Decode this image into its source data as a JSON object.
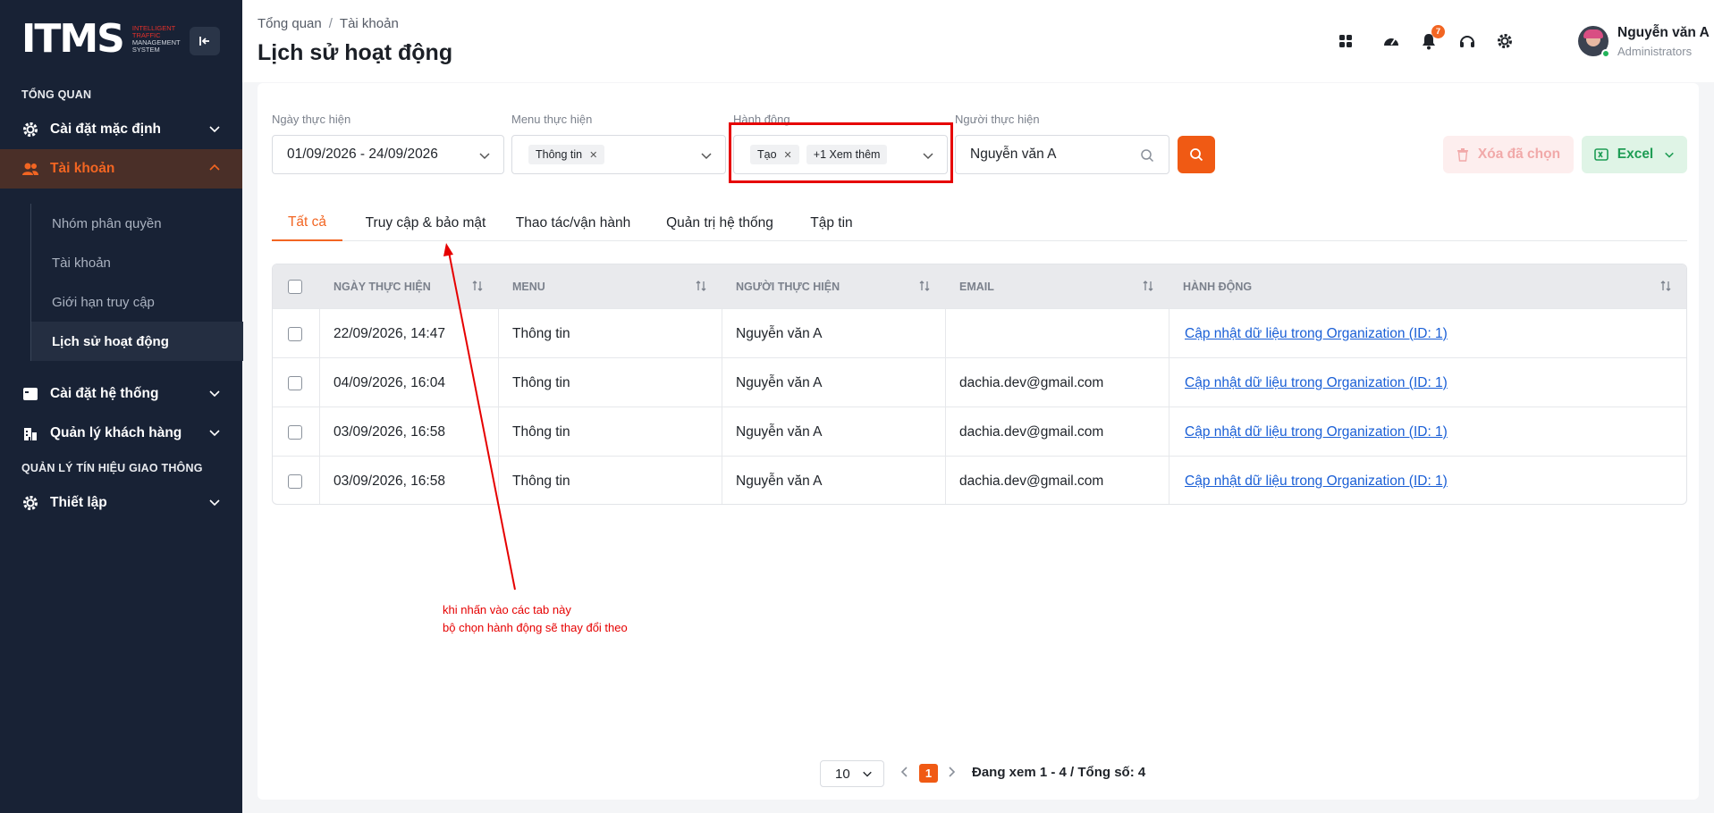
{
  "sidebar": {
    "logo_mark": "ITMS",
    "logo_sub": [
      "Intelligent",
      "Traffic",
      "Management",
      "System"
    ],
    "section_overview": "TỔNG QUAN",
    "section_traffic": "QUẢN LÝ TÍN HIỆU GIAO THÔNG",
    "items": [
      {
        "label": "Cài đặt mặc định"
      },
      {
        "label": "Tài khoản"
      },
      {
        "label": "Cài đặt hệ thống"
      },
      {
        "label": "Quản lý khách hàng"
      },
      {
        "label": "Thiết lập"
      }
    ],
    "sub_items": [
      {
        "label": "Nhóm phân quyền"
      },
      {
        "label": "Tài khoản"
      },
      {
        "label": "Giới hạn truy cập"
      },
      {
        "label": "Lịch sử hoạt động"
      }
    ]
  },
  "header": {
    "breadcrumb": [
      "Tổng quan",
      "Tài khoản"
    ],
    "title": "Lịch sử hoạt động",
    "notification_count": "7",
    "user_name": "Nguyễn văn A",
    "user_role": "Administrators"
  },
  "filters": {
    "date_label": "Ngày thực hiện",
    "date_value": "01/09/2026 - 24/09/2026",
    "menu_label": "Menu thực hiện",
    "menu_tag": "Thông tin",
    "action_label": "Hành động",
    "action_tag": "Tạo",
    "action_more": "+1 Xem thêm",
    "user_label": "Người thực hiện",
    "user_value": "Nguyễn văn A",
    "delete_label": "Xóa đã chọn",
    "excel_label": "Excel"
  },
  "tabs": [
    "Tất cả",
    "Truy cập & bảo mật",
    "Thao tác/vận hành",
    "Quản trị hệ thống",
    "Tập tin"
  ],
  "table": {
    "columns": [
      "NGÀY THỰC HIỆN",
      "MENU",
      "NGƯỜI THỰC HIỆN",
      "EMAIL",
      "HÀNH ĐỘNG"
    ],
    "rows": [
      {
        "date": "22/09/2026, 14:47",
        "menu": "Thông tin",
        "user": "Nguyễn văn A",
        "email": "",
        "action": "Cập nhật dữ liệu trong Organization (ID: 1)"
      },
      {
        "date": "04/09/2026, 16:04",
        "menu": "Thông tin",
        "user": "Nguyễn văn A",
        "email": "dachia.dev@gmail.com",
        "action": "Cập nhật dữ liệu trong Organization (ID: 1)"
      },
      {
        "date": "03/09/2026, 16:58",
        "menu": "Thông tin",
        "user": "Nguyễn văn A",
        "email": "dachia.dev@gmail.com",
        "action": "Cập nhật dữ liệu trong Organization (ID: 1)"
      },
      {
        "date": "03/09/2026, 16:58",
        "menu": "Thông tin",
        "user": "Nguyễn văn A",
        "email": "dachia.dev@gmail.com",
        "action": "Cập nhật dữ liệu trong Organization (ID: 1)"
      }
    ]
  },
  "annotation": {
    "line1": "khi nhấn vào các tab này",
    "line2": "bộ chọn hành động sẽ thay đổi theo",
    "color": "#e60000"
  },
  "pagination": {
    "page_size": "10",
    "current_page": "1",
    "info": "Đang xem 1 - 4 / Tổng số: 4"
  },
  "colors": {
    "accent": "#f26522",
    "sidebar_bg": "#182235",
    "link": "#1a5fd6",
    "excel": "#1f9d55"
  }
}
